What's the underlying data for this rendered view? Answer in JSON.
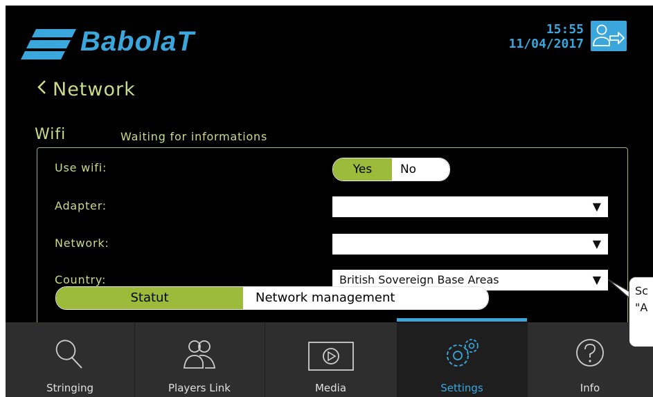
{
  "header": {
    "brand": "BabolaT",
    "time": "15:55",
    "date": "11/04/2017"
  },
  "page": {
    "back_title": "Network",
    "section_title": "Wifi",
    "section_status": "Waiting for informations"
  },
  "form": {
    "use_wifi_label": "Use wifi:",
    "use_wifi_yes": "Yes",
    "use_wifi_no": "No",
    "use_wifi_selected": "Yes",
    "adapter_label": "Adapter:",
    "adapter_value": "",
    "network_label": "Network:",
    "network_value": "",
    "country_label": "Country:",
    "country_value": "British Sovereign Base Areas"
  },
  "segment": {
    "statut": "Statut",
    "network_management": "Network management",
    "selected": "Statut"
  },
  "tabs": [
    {
      "label": "Stringing",
      "icon": "racket-icon"
    },
    {
      "label": "Players Link",
      "icon": "players-icon"
    },
    {
      "label": "Media",
      "icon": "play-icon"
    },
    {
      "label": "Settings",
      "icon": "gears-icon",
      "active": true
    },
    {
      "label": "Info",
      "icon": "question-icon"
    }
  ],
  "tooltip": {
    "text": "Sc\n\"A"
  },
  "colors": {
    "accent_blue": "#3ba6dc",
    "accent_green": "#9dbb3a",
    "label_yellow": "#cfd98a",
    "background": "#000000",
    "tabbar": "#2e2e2e"
  }
}
